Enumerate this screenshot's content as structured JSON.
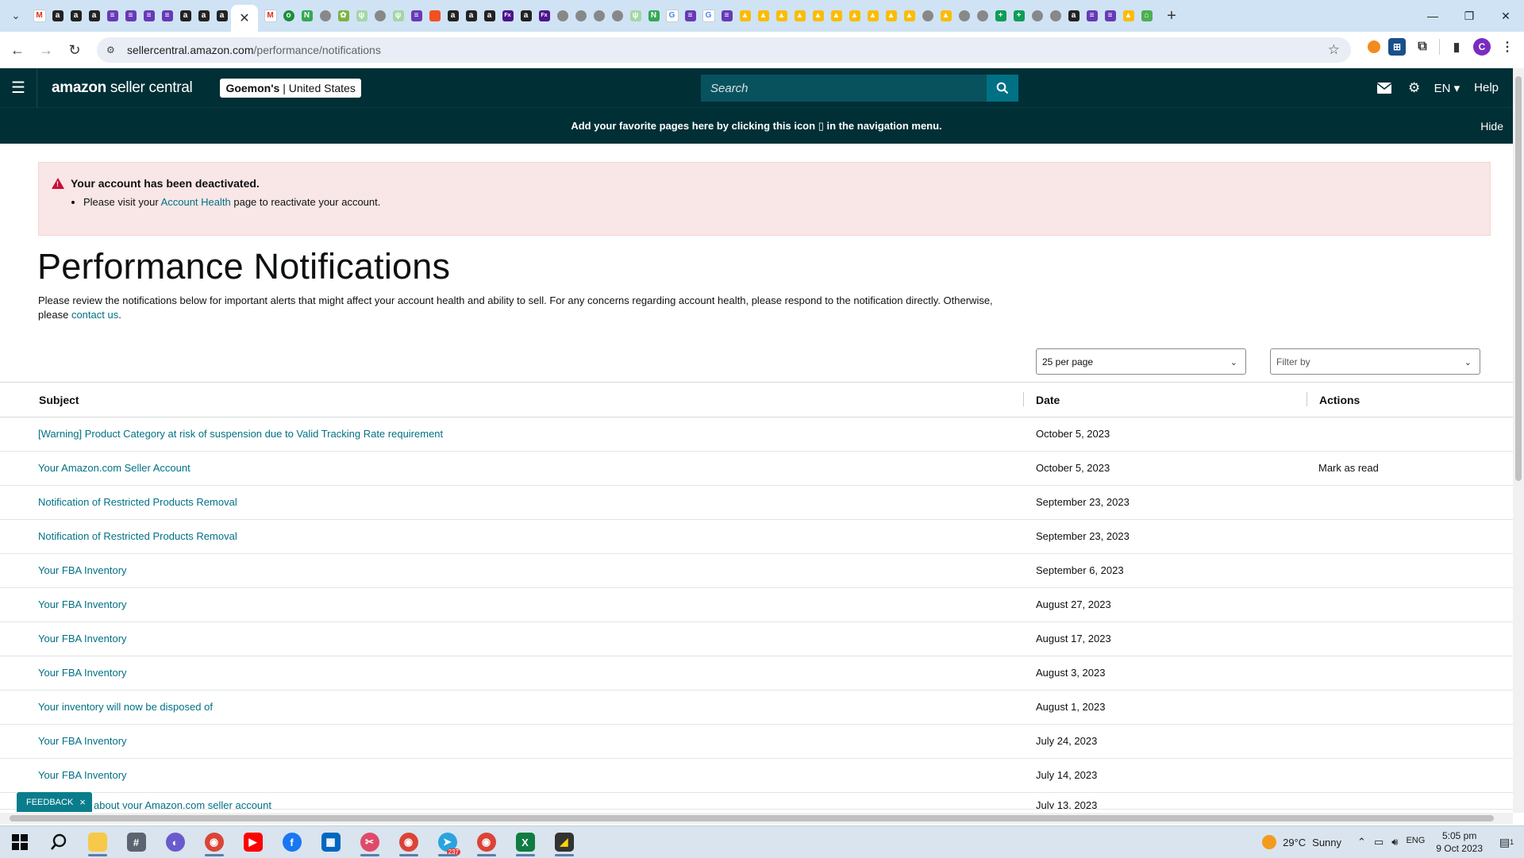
{
  "browser": {
    "url_host": "sellercentral.amazon.com",
    "url_path": "/performance/notifications",
    "active_tab_close": "✕",
    "new_tab": "+"
  },
  "header": {
    "logo_bold": "amazon",
    "logo_light": " seller central",
    "account_name": "Goemon's",
    "account_region": "United States",
    "search_placeholder": "Search",
    "language": "EN",
    "help": "Help"
  },
  "banner": {
    "text": "Add your favorite pages here by clicking this icon",
    "text_after": "in the navigation menu.",
    "hide": "Hide"
  },
  "alert": {
    "title": "Your account has been deactivated.",
    "line_before": "Please visit your",
    "line_link": "Account Health",
    "line_after": "page to reactivate your account."
  },
  "page": {
    "title": "Performance Notifications",
    "description": "Please review the notifications below for important alerts that might affect your account health and ability to sell. For any concerns regarding account health, please respond to the notification directly. Otherwise, please",
    "contact_link": "contact us",
    "per_page": "25 per page",
    "filter_placeholder": "Filter by"
  },
  "table": {
    "headers": {
      "subject": "Subject",
      "date": "Date",
      "actions": "Actions"
    },
    "rows": [
      {
        "subject": "[Warning] Product Category at risk of suspension due to Valid Tracking Rate requirement",
        "date": "October 5, 2023",
        "action": ""
      },
      {
        "subject": "Your Amazon.com Seller Account",
        "date": "October 5, 2023",
        "action": "Mark as read"
      },
      {
        "subject": "Notification of Restricted Products Removal",
        "date": "September 23, 2023",
        "action": ""
      },
      {
        "subject": "Notification of Restricted Products Removal",
        "date": "September 23, 2023",
        "action": ""
      },
      {
        "subject": "Your FBA Inventory",
        "date": "September 6, 2023",
        "action": ""
      },
      {
        "subject": "Your FBA Inventory",
        "date": "August 27, 2023",
        "action": ""
      },
      {
        "subject": "Your FBA Inventory",
        "date": "August 17, 2023",
        "action": ""
      },
      {
        "subject": "Your FBA Inventory",
        "date": "August 3, 2023",
        "action": ""
      },
      {
        "subject": "Your inventory will now be disposed of",
        "date": "August 1, 2023",
        "action": ""
      },
      {
        "subject": "Your FBA Inventory",
        "date": "July 24, 2023",
        "action": ""
      },
      {
        "subject": "Your FBA Inventory",
        "date": "July 14, 2023",
        "action": ""
      },
      {
        "subject": "about your Amazon.com seller account",
        "date": "July 13, 2023",
        "action": ""
      }
    ]
  },
  "feedback": {
    "label": "FEEDBACK",
    "close": "×"
  },
  "taskbar": {
    "temperature": "29°C",
    "condition": "Sunny",
    "language": "ENG",
    "time": "5:05 pm",
    "date": "9 Oct 2023",
    "notification_count": "1",
    "telegram_badge": "237"
  },
  "colors": {
    "header_bg": "#002f36",
    "link": "#007185",
    "alert_bg": "#f9e6e6",
    "alert_icon": "#cc0c39"
  }
}
